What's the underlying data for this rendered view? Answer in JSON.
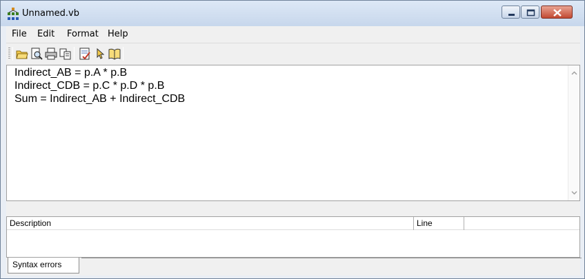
{
  "window": {
    "title": "Unnamed.vb",
    "icon": "network-app-icon",
    "controls": [
      "minimize-icon",
      "maximize-icon",
      "close-icon"
    ]
  },
  "menu": {
    "items": [
      {
        "label": "File"
      },
      {
        "label": "Edit"
      },
      {
        "label": "Format"
      },
      {
        "label": "Help"
      }
    ]
  },
  "toolbar": {
    "buttons": [
      {
        "icon": "open-folder-icon"
      },
      {
        "icon": "print-preview-icon"
      },
      {
        "icon": "printer-icon"
      },
      {
        "icon": "copy-icon"
      },
      {
        "icon": "check-syntax-icon"
      },
      {
        "icon": "pointer-help-icon"
      },
      {
        "icon": "book-icon"
      }
    ]
  },
  "editor": {
    "lines": [
      "Indirect_AB = p.A * p.B",
      "Indirect_CDB = p.C * p.D * p.B",
      "Sum = Indirect_AB + Indirect_CDB"
    ]
  },
  "errors": {
    "columns": [
      "Description",
      "Line",
      ""
    ],
    "rows": []
  },
  "tabs": [
    {
      "label": "Syntax errors"
    }
  ],
  "colors": {
    "titlebar": "#c7d7ec",
    "close_button": "#c24a33",
    "chrome": "#f0f0f0"
  }
}
